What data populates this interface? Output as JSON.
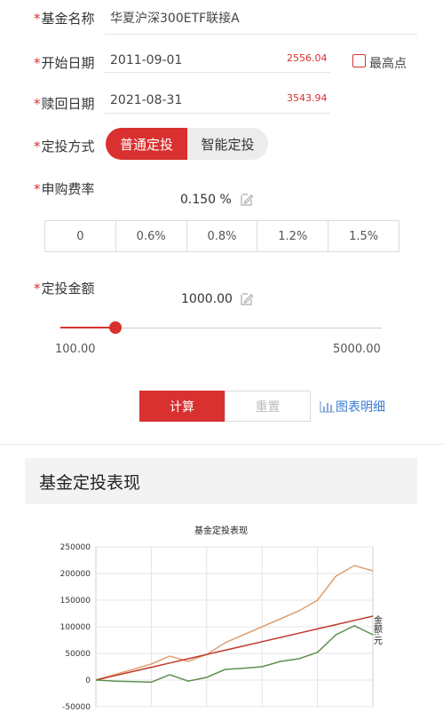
{
  "form": {
    "fund": {
      "label": "基金名称",
      "value": "华夏沪深300ETF联接A"
    },
    "start": {
      "label": "开始日期",
      "value": "2011-09-01",
      "price": "2556.04"
    },
    "highest": {
      "label": "最高点",
      "checked": false
    },
    "redeem": {
      "label": "赎回日期",
      "value": "2021-08-31",
      "price": "3543.94"
    },
    "method": {
      "label": "定投方式",
      "options": [
        "普通定投",
        "智能定投"
      ],
      "selected": "普通定投"
    },
    "fee": {
      "label": "申购费率",
      "value": "0.150 %",
      "options": [
        "0",
        "0.6%",
        "0.8%",
        "1.2%",
        "1.5%"
      ]
    },
    "amount": {
      "label": "定投金额",
      "value": "1000.00",
      "min": "100.00",
      "max": "5000.00",
      "slider_fraction": 0.17
    }
  },
  "actions": {
    "calc": "计算",
    "reset": "重置",
    "detail": "图表明细"
  },
  "section": {
    "title": "基金定投表现"
  },
  "colors": {
    "accent": "#d93030",
    "link": "#3a7bd5"
  },
  "chart_data": {
    "type": "line",
    "title": "基金定投表现",
    "ylim": [
      -50000,
      250000
    ],
    "y_ticks": [
      "250000",
      "200000",
      "150000",
      "100000",
      "50000",
      "0",
      "-50000"
    ],
    "grid": true,
    "legend_text": "金额:元",
    "series": [
      {
        "color": "#e0a070",
        "values": [
          0,
          10000,
          20000,
          30000,
          45000,
          35000,
          48000,
          70000,
          85000,
          100000,
          115000,
          130000,
          150000,
          195000,
          215000,
          205000
        ]
      },
      {
        "color": "#c0392b",
        "values": [
          0,
          8000,
          16000,
          24000,
          32000,
          40000,
          48000,
          56000,
          64000,
          72000,
          80000,
          88000,
          96000,
          104000,
          112000,
          120000
        ]
      },
      {
        "color": "#5f8f4f",
        "values": [
          0,
          -2000,
          -3000,
          -4000,
          10000,
          -2000,
          5000,
          20000,
          22000,
          25000,
          35000,
          40000,
          52000,
          85000,
          102000,
          85000
        ]
      }
    ]
  }
}
